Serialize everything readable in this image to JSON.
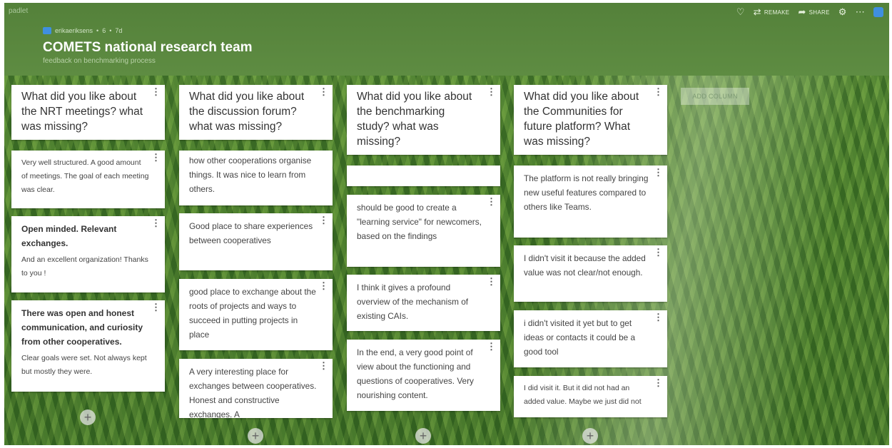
{
  "app": {
    "brand": "padlet"
  },
  "toolbar": {
    "remake_label": "REMAKE",
    "share_label": "SHARE"
  },
  "board": {
    "author": "erikaeriksens",
    "count": "6",
    "age": "7d",
    "title": "COMETS national research team",
    "subtitle": "feedback on benchmarking process"
  },
  "columns": [
    {
      "title": "What did you like about the NRT meetings? what was missing?",
      "cards": [
        {
          "text": "Very well structured. A good amount of meetings. The goal of each meeting was clear."
        },
        {
          "bold": "Open minded. Relevant exchanges.",
          "text": "And an excellent organization! Thanks to you !"
        },
        {
          "bold": "There was open and honest communication, and curiosity from other cooperatives.",
          "text": "Clear goals were set. Not always kept but mostly they were."
        }
      ]
    },
    {
      "title": "What did you like about the discussion forum? what was missing?",
      "cards": [
        {
          "text": "how other cooperations organise things. It was nice to learn from others."
        },
        {
          "text": "Good place to share experiences between cooperatives"
        },
        {
          "text": "good place to exchange about the roots of projects and ways to succeed in putting projects in place"
        },
        {
          "text": "A very interesting place for exchanges between cooperatives. Honest and constructive exchanges. A"
        }
      ]
    },
    {
      "title": "What did you like about the benchmarking study? what was missing?",
      "cards": [
        {
          "text": ""
        },
        {
          "text": "should be good to create a \"learning service\" for newcomers, based on the findings"
        },
        {
          "text": "I think it gives a profound overview of the mechanism of existing CAIs."
        },
        {
          "text": "In the end, a very good point of view about the functioning and questions of cooperatives. Very nourishing content."
        }
      ]
    },
    {
      "title": "What did you like about the Communities for future platform? What was missing?",
      "cards": [
        {
          "text": "The platform is not really bringing new useful features compared to others like Teams."
        },
        {
          "text": "I didn't visit it because the added value was not clear/not enough."
        },
        {
          "text": "i didn't visited it yet but to get ideas or contacts it could be a good tool"
        },
        {
          "text": "I did visit it. But it did not had an added value. Maybe we just did not"
        }
      ]
    }
  ],
  "add_column_label": "ADD COLUMN"
}
